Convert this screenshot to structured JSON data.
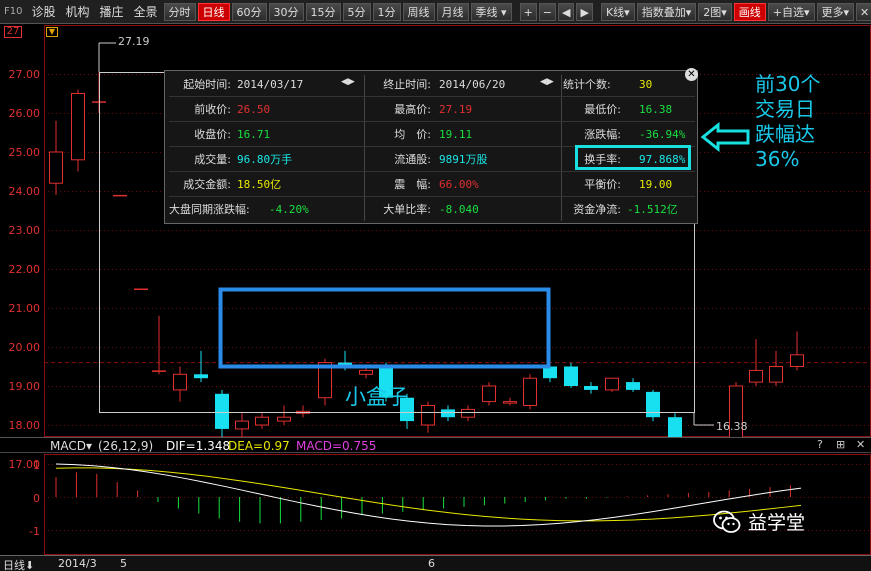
{
  "toolbar": {
    "brand": "F10",
    "menu": [
      "诊股",
      "机构",
      "播庄",
      "全景"
    ],
    "periods": [
      "分时",
      "日线",
      "60分",
      "30分",
      "15分",
      "5分",
      "1分",
      "周线",
      "月线",
      "季线"
    ],
    "active_period": "日线",
    "nav": [
      "+",
      "−",
      "◀",
      "▶"
    ],
    "right": [
      "K线",
      "指数叠加",
      "2图",
      "画线",
      "+自选",
      "更多"
    ],
    "active_right": "画线"
  },
  "main": {
    "header_marker": "27",
    "price_axis": [
      "27.00",
      "26.00",
      "25.00",
      "24.00",
      "23.00",
      "22.00",
      "21.00",
      "20.00",
      "19.00",
      "18.00",
      "17.00"
    ],
    "high_annotation": "27.19",
    "low_annotation": "16.38",
    "colors": {
      "up": "#e03030",
      "down": "#19e0f0",
      "frame": "#8a1010",
      "highlight": "#2a8ce8"
    }
  },
  "stats": {
    "row1": {
      "l1": "起始时间:",
      "v1": "2014/03/17",
      "l2": "终止时间:",
      "v2": "2014/06/20",
      "l3": "统计个数:",
      "v3": "30"
    },
    "row2": {
      "l1": "前收价:",
      "v1": "26.50",
      "l2": "最高价:",
      "v2": "27.19",
      "l3": "最低价:",
      "v3": "16.38"
    },
    "row3": {
      "l1": "收盘价:",
      "v1": "16.71",
      "l2": "均　价:",
      "v2": "19.11",
      "l3": "涨跌幅:",
      "v3": "-36.94%"
    },
    "row4": {
      "l1": "成交量:",
      "v1": "96.80万手",
      "l2": "流通股:",
      "v2": "9891万股",
      "l3": "换手率:",
      "v3": "97.868%"
    },
    "row5": {
      "l1": "成交金额:",
      "v1": "18.50亿",
      "l2": "震　幅:",
      "v2": "66.00%",
      "l3": "平衡价:",
      "v3": "19.00"
    },
    "row6": {
      "l1": "大盘同期涨跌幅:",
      "v1": "-4.20%",
      "l2": "大单比率:",
      "v2": "-8.040",
      "l3": "资金净流:",
      "v3": "-1.512亿"
    },
    "close_glyph": "✕",
    "arrow_glyph": "◀▶"
  },
  "callout": {
    "lines": [
      "前30个",
      "交易日",
      "跌幅达",
      "36%"
    ]
  },
  "box_caption": "小盒子",
  "macd": {
    "name": "MACD",
    "params": "(26,12,9)",
    "dif": "DIF=1.348",
    "dea": "DEA=0.97",
    "macd": "MACD=0.755",
    "axis": [
      "1",
      "0",
      "-1"
    ],
    "controls": [
      "?",
      "⊞",
      "✕"
    ]
  },
  "date_bar": {
    "period": "日线",
    "labels": [
      "2014/3",
      "5",
      "6"
    ]
  },
  "watermark": "益学堂"
}
